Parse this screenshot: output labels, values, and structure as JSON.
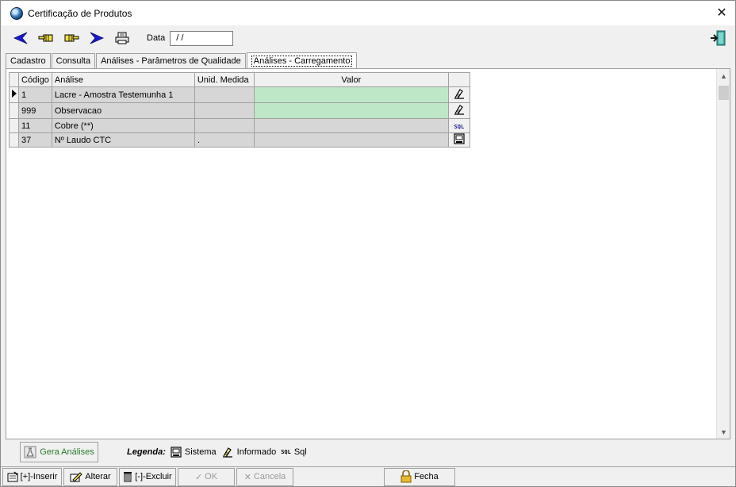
{
  "window": {
    "title": "Certificação de Produtos",
    "close_label": "✕"
  },
  "toolbar": {
    "date_label": "Data",
    "date_value": " / /",
    "buttons": [
      "first-record",
      "previous-record",
      "next-record",
      "last-record",
      "print"
    ]
  },
  "tabs": [
    {
      "label": "Cadastro",
      "active": false
    },
    {
      "label": "Consulta",
      "active": false
    },
    {
      "label": "Análises - Parâmetros de Qualidade",
      "active": false
    },
    {
      "label": "Análises - Carregamento",
      "active": true
    }
  ],
  "grid": {
    "columns": [
      "Código",
      "Análise",
      "Unid. Medida",
      "Valor",
      ""
    ],
    "rows": [
      {
        "codigo": "1",
        "analise": "Lacre - Amostra Testemunha 1",
        "unidade": "",
        "valor": "",
        "tipo": "informado",
        "current": true,
        "editable": true
      },
      {
        "codigo": "999",
        "analise": "Observacao",
        "unidade": "",
        "valor": "",
        "tipo": "informado",
        "current": false,
        "editable": true
      },
      {
        "codigo": "11",
        "analise": "Cobre (**)",
        "unidade": "",
        "valor": "",
        "tipo": "sql",
        "current": false,
        "editable": false
      },
      {
        "codigo": "37",
        "analise": "Nº Laudo CTC",
        "unidade": ".",
        "valor": "",
        "tipo": "sistema",
        "current": false,
        "editable": false
      }
    ]
  },
  "legend": {
    "gera_button": "Gera Análises",
    "title": "Legenda:",
    "items": [
      {
        "icon": "sistema-icon",
        "label": "Sistema"
      },
      {
        "icon": "informado-icon",
        "label": "Informado"
      },
      {
        "icon": "sql-icon",
        "label": "Sql",
        "icon_text": "SQL"
      }
    ]
  },
  "bottom_buttons": {
    "inserir": "[+]-Inserir",
    "alterar": "Alterar",
    "excluir": "[-]-Excluir",
    "ok": "OK",
    "cancela": "Cancela",
    "fecha": "Fecha"
  },
  "colors": {
    "editable_cell": "#bde7c6",
    "readonly_cell": "#d6d6d6",
    "nav_arrow": "#1a1ad0",
    "gera_text": "#2b7a2b"
  }
}
